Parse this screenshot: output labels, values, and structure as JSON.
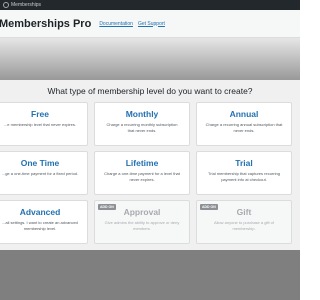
{
  "adminbar": {
    "site_name": "Memberships"
  },
  "header": {
    "title": "Memberships Pro",
    "links": [
      "Documentation",
      "Get Support"
    ]
  },
  "modal": {
    "title": "What type of membership level do you want to create?",
    "cards": [
      {
        "name": "Free",
        "desc": "...e membership level that never expires.",
        "badge": ""
      },
      {
        "name": "Monthly",
        "desc": "Charge a recurring monthly subscription that never ends.",
        "badge": ""
      },
      {
        "name": "Annual",
        "desc": "Charge a recurring annual subscription that never ends.",
        "badge": ""
      },
      {
        "name": "One Time",
        "desc": "...ge a one-time payment for a fixed period.",
        "badge": ""
      },
      {
        "name": "Lifetime",
        "desc": "Charge a one-time payment for a level that never expires.",
        "badge": ""
      },
      {
        "name": "Trial",
        "desc": "Trial membership that captures recurring payment info at checkout.",
        "badge": ""
      },
      {
        "name": "Advanced",
        "desc": "...all settings. I want to create an advanced membership level.",
        "badge": ""
      },
      {
        "name": "Approval",
        "desc": "Give admins the ability to approve or deny members.",
        "badge": "ADD ON"
      },
      {
        "name": "Gift",
        "desc": "Allow anyone to purchase a gift of membership.",
        "badge": "ADD ON"
      }
    ]
  }
}
